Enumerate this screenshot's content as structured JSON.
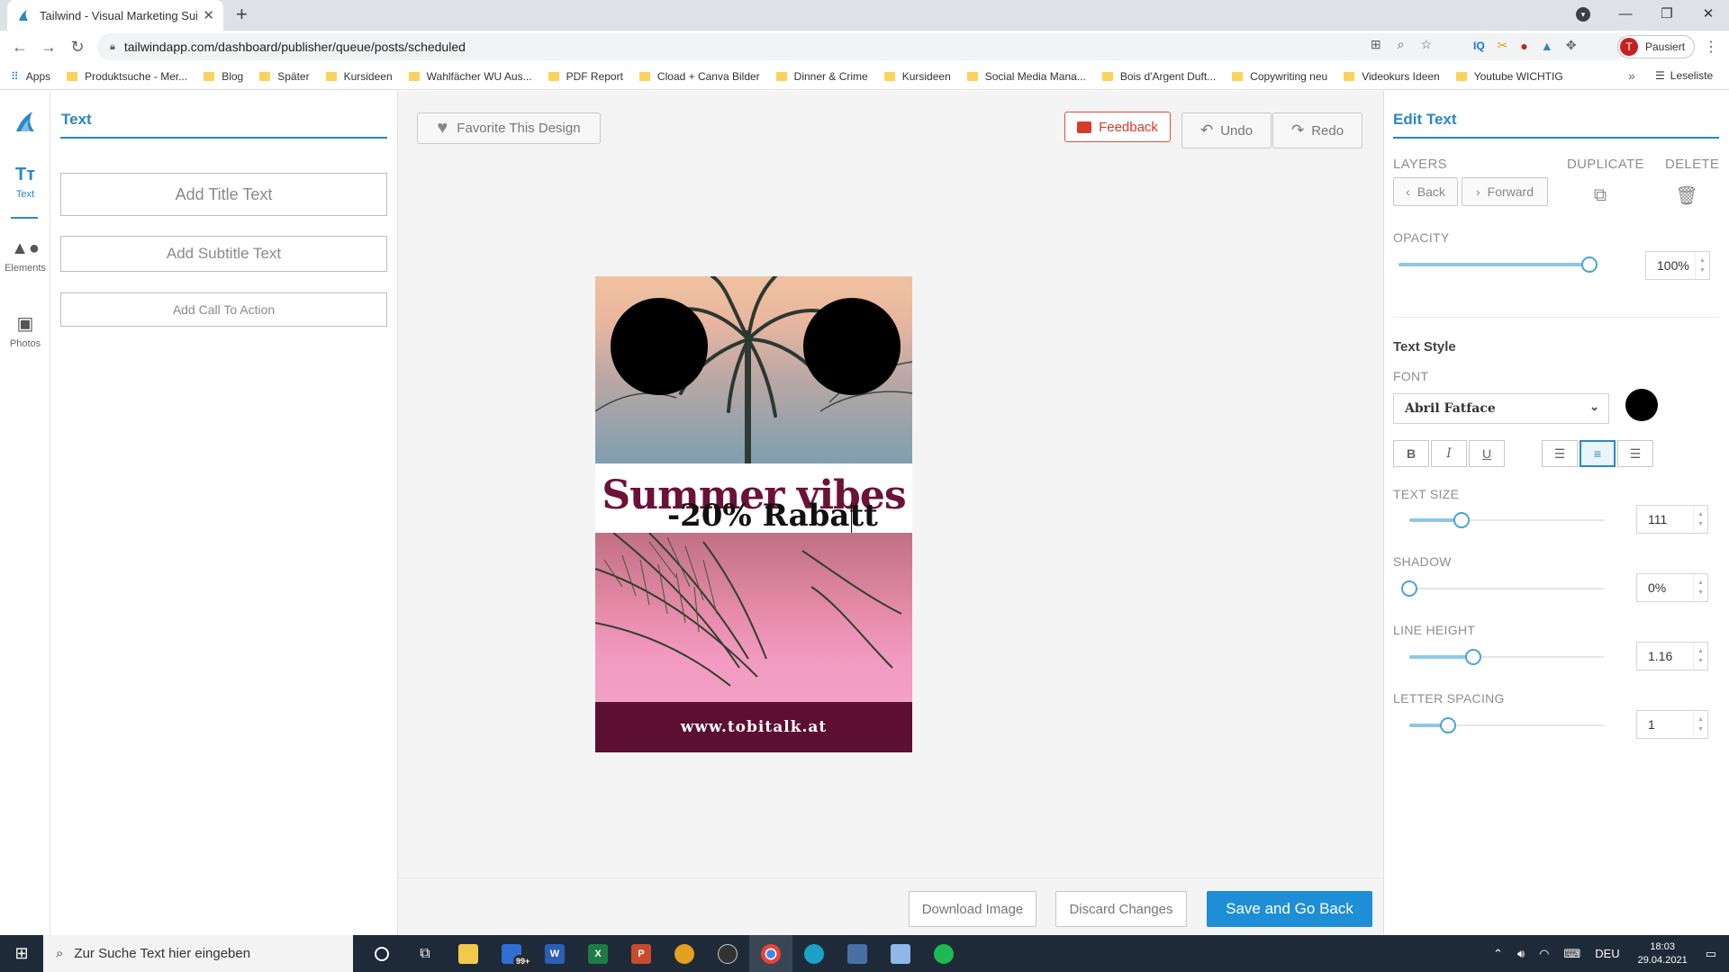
{
  "browser": {
    "tab_title": "Tailwind - Visual Marketing Suite",
    "tab_close": "✕",
    "new_tab": "+",
    "url": "tailwindapp.com/dashboard/publisher/queue/posts/scheduled",
    "profile_initial": "T",
    "profile_label": "Pausiert",
    "bookmarks": [
      "Apps",
      "Produktsuche - Mer...",
      "Blog",
      "Später",
      "Kursideen",
      "Wahlfächer WU Aus...",
      "PDF Report",
      "Cload + Canva Bilder",
      "Dinner & Crime",
      "Kursideen",
      "Social Media Mana...",
      "Bois d'Argent Duft...",
      "Copywriting neu",
      "Videokurs Ideen",
      "Youtube WICHTIG"
    ],
    "bookmarks_more": "»",
    "reading_list": "Leseliste"
  },
  "iconbar": {
    "items": [
      {
        "label": "Text",
        "icon": "text-icon"
      },
      {
        "label": "Elements",
        "icon": "shapes-icon"
      },
      {
        "label": "Photos",
        "icon": "photo-icon"
      }
    ]
  },
  "leftpanel": {
    "title": "Text",
    "add_title": "Add Title Text",
    "add_subtitle": "Add Subtitle Text",
    "add_cta": "Add Call To Action"
  },
  "canvas": {
    "favorite_label": "Favorite This Design",
    "feedback_label": "Feedback",
    "undo_label": "Undo",
    "redo_label": "Redo",
    "design": {
      "headline": "Summer vibes",
      "subline": "-20% Rabatt",
      "footer": "www.tobitalk.at"
    }
  },
  "bottombar": {
    "download_label": "Download Image",
    "discard_label": "Discard Changes",
    "save_label": "Save and Go Back"
  },
  "rightpanel": {
    "title": "Edit Text",
    "layers_label": "LAYERS",
    "back_label": "Back",
    "forward_label": "Forward",
    "duplicate_label": "DUPLICATE",
    "delete_label": "DELETE",
    "opacity_label": "OPACITY",
    "opacity_value": "100%",
    "opacity_fraction": 1.0,
    "text_style_heading": "Text Style",
    "font_label": "FONT",
    "font_value": "Abril Fatface",
    "font_color": "#000000",
    "format_buttons": {
      "bold": "B",
      "italic": "I",
      "underline": "U"
    },
    "align_active": "center",
    "text_size_label": "TEXT SIZE",
    "text_size_value": "111",
    "text_size_fraction": 0.27,
    "shadow_label": "SHADOW",
    "shadow_value": "0%",
    "shadow_fraction": 0.0,
    "line_height_label": "LINE HEIGHT",
    "line_height_value": "1.16",
    "line_height_fraction": 0.33,
    "letter_spacing_label": "LETTER SPACING",
    "letter_spacing_value": "1",
    "letter_spacing_fraction": 0.2
  },
  "taskbar": {
    "search_placeholder": "Zur Suche Text hier eingeben",
    "mail_badge": "99+",
    "language": "DEU",
    "time": "18:03",
    "date": "29.04.2021"
  },
  "colors": {
    "accent": "#2a87c8",
    "save_button": "#1e8fd6",
    "feedback": "#d93b2b",
    "design_headline": "#6b1238",
    "design_footer": "#5c0f33"
  }
}
